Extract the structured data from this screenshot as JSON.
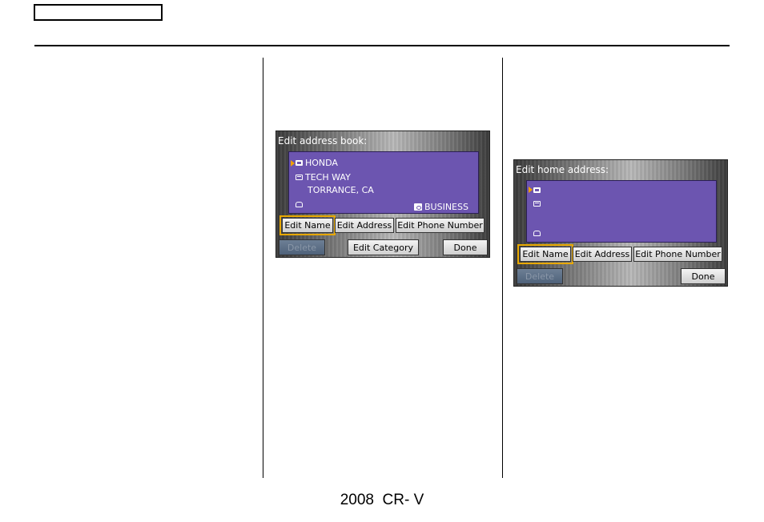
{
  "footer": {
    "text": "2008  CR- V"
  },
  "screen1": {
    "title": "Edit address book:",
    "entry": {
      "name": "HONDA",
      "address_line1": "TECH WAY",
      "address_line2": "TORRANCE, CA",
      "category": "BUSINESS"
    },
    "buttons": {
      "edit_name": "Edit Name",
      "edit_address": "Edit Address",
      "edit_phone": "Edit Phone Number",
      "delete": "Delete",
      "edit_category": "Edit Category",
      "done": "Done"
    }
  },
  "screen2": {
    "title": "Edit home address:",
    "buttons": {
      "edit_name": "Edit Name",
      "edit_address": "Edit Address",
      "edit_phone": "Edit Phone Number",
      "delete": "Delete",
      "done": "Done"
    }
  },
  "colors": {
    "list_background": "#6c55b0",
    "selection_outline": "#e8a800",
    "disabled_button": "#5a6c84"
  }
}
